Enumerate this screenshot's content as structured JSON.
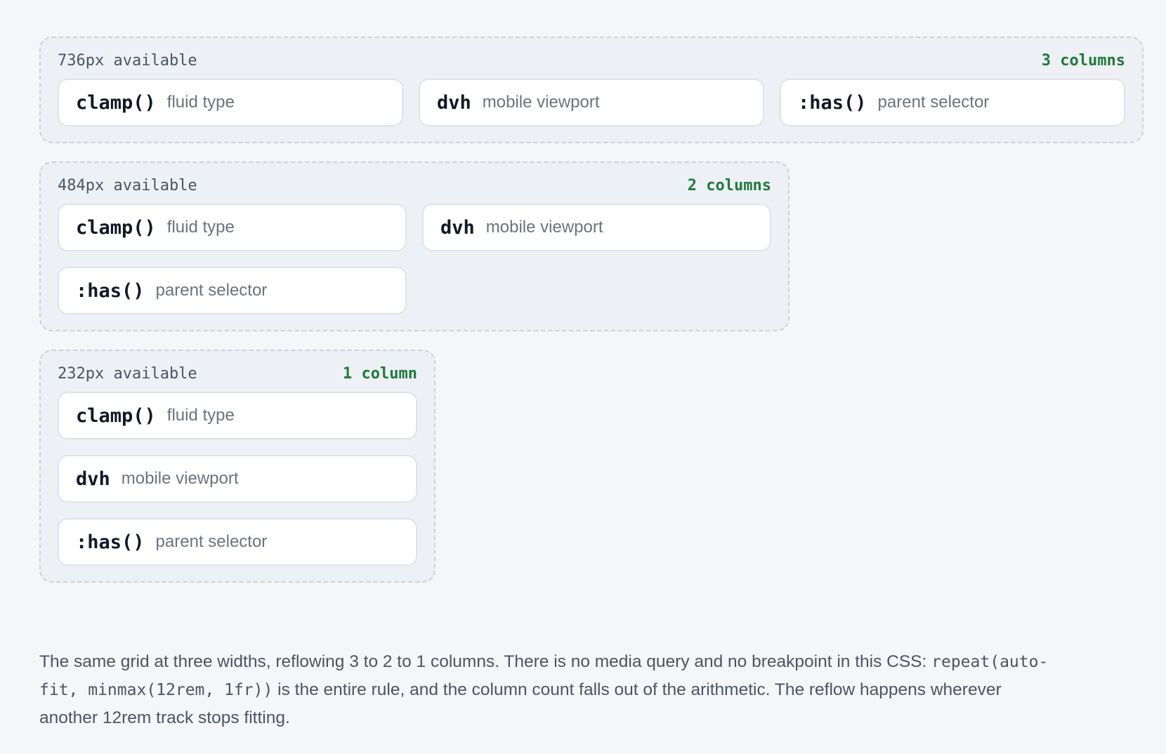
{
  "frames": [
    {
      "available": "736px available",
      "columns_label": "3 columns",
      "columns": 3,
      "cards": [
        {
          "name": "clamp()",
          "desc": "fluid type"
        },
        {
          "name": "dvh",
          "desc": "mobile viewport"
        },
        {
          "name": ":has()",
          "desc": "parent selector"
        }
      ]
    },
    {
      "available": "484px available",
      "columns_label": "2 columns",
      "columns": 2,
      "cards": [
        {
          "name": "clamp()",
          "desc": "fluid type"
        },
        {
          "name": "dvh",
          "desc": "mobile viewport"
        },
        {
          "name": ":has()",
          "desc": "parent selector"
        }
      ]
    },
    {
      "available": "232px available",
      "columns_label": "1 column",
      "columns": 1,
      "cards": [
        {
          "name": "clamp()",
          "desc": "fluid type"
        },
        {
          "name": "dvh",
          "desc": "mobile viewport"
        },
        {
          "name": ":has()",
          "desc": "parent selector"
        }
      ]
    }
  ],
  "caption": {
    "text1": "The same grid at three widths, reflowing 3 to 2 to 1 columns. There is no media query and no breakpoint in this CSS: ",
    "code": "repeat(auto-fit, minmax(12rem, 1fr))",
    "text2": " is the entire rule, and the column count falls out of the arithmetic. The reflow happens wherever another 12rem track stops fitting."
  },
  "colors": {
    "background": "#f5f6f8",
    "frame_fill": "#edf0f4",
    "frame_border": "#cdd2da",
    "columns_accent": "#1f7a3a",
    "card_fill": "#ffffff"
  }
}
